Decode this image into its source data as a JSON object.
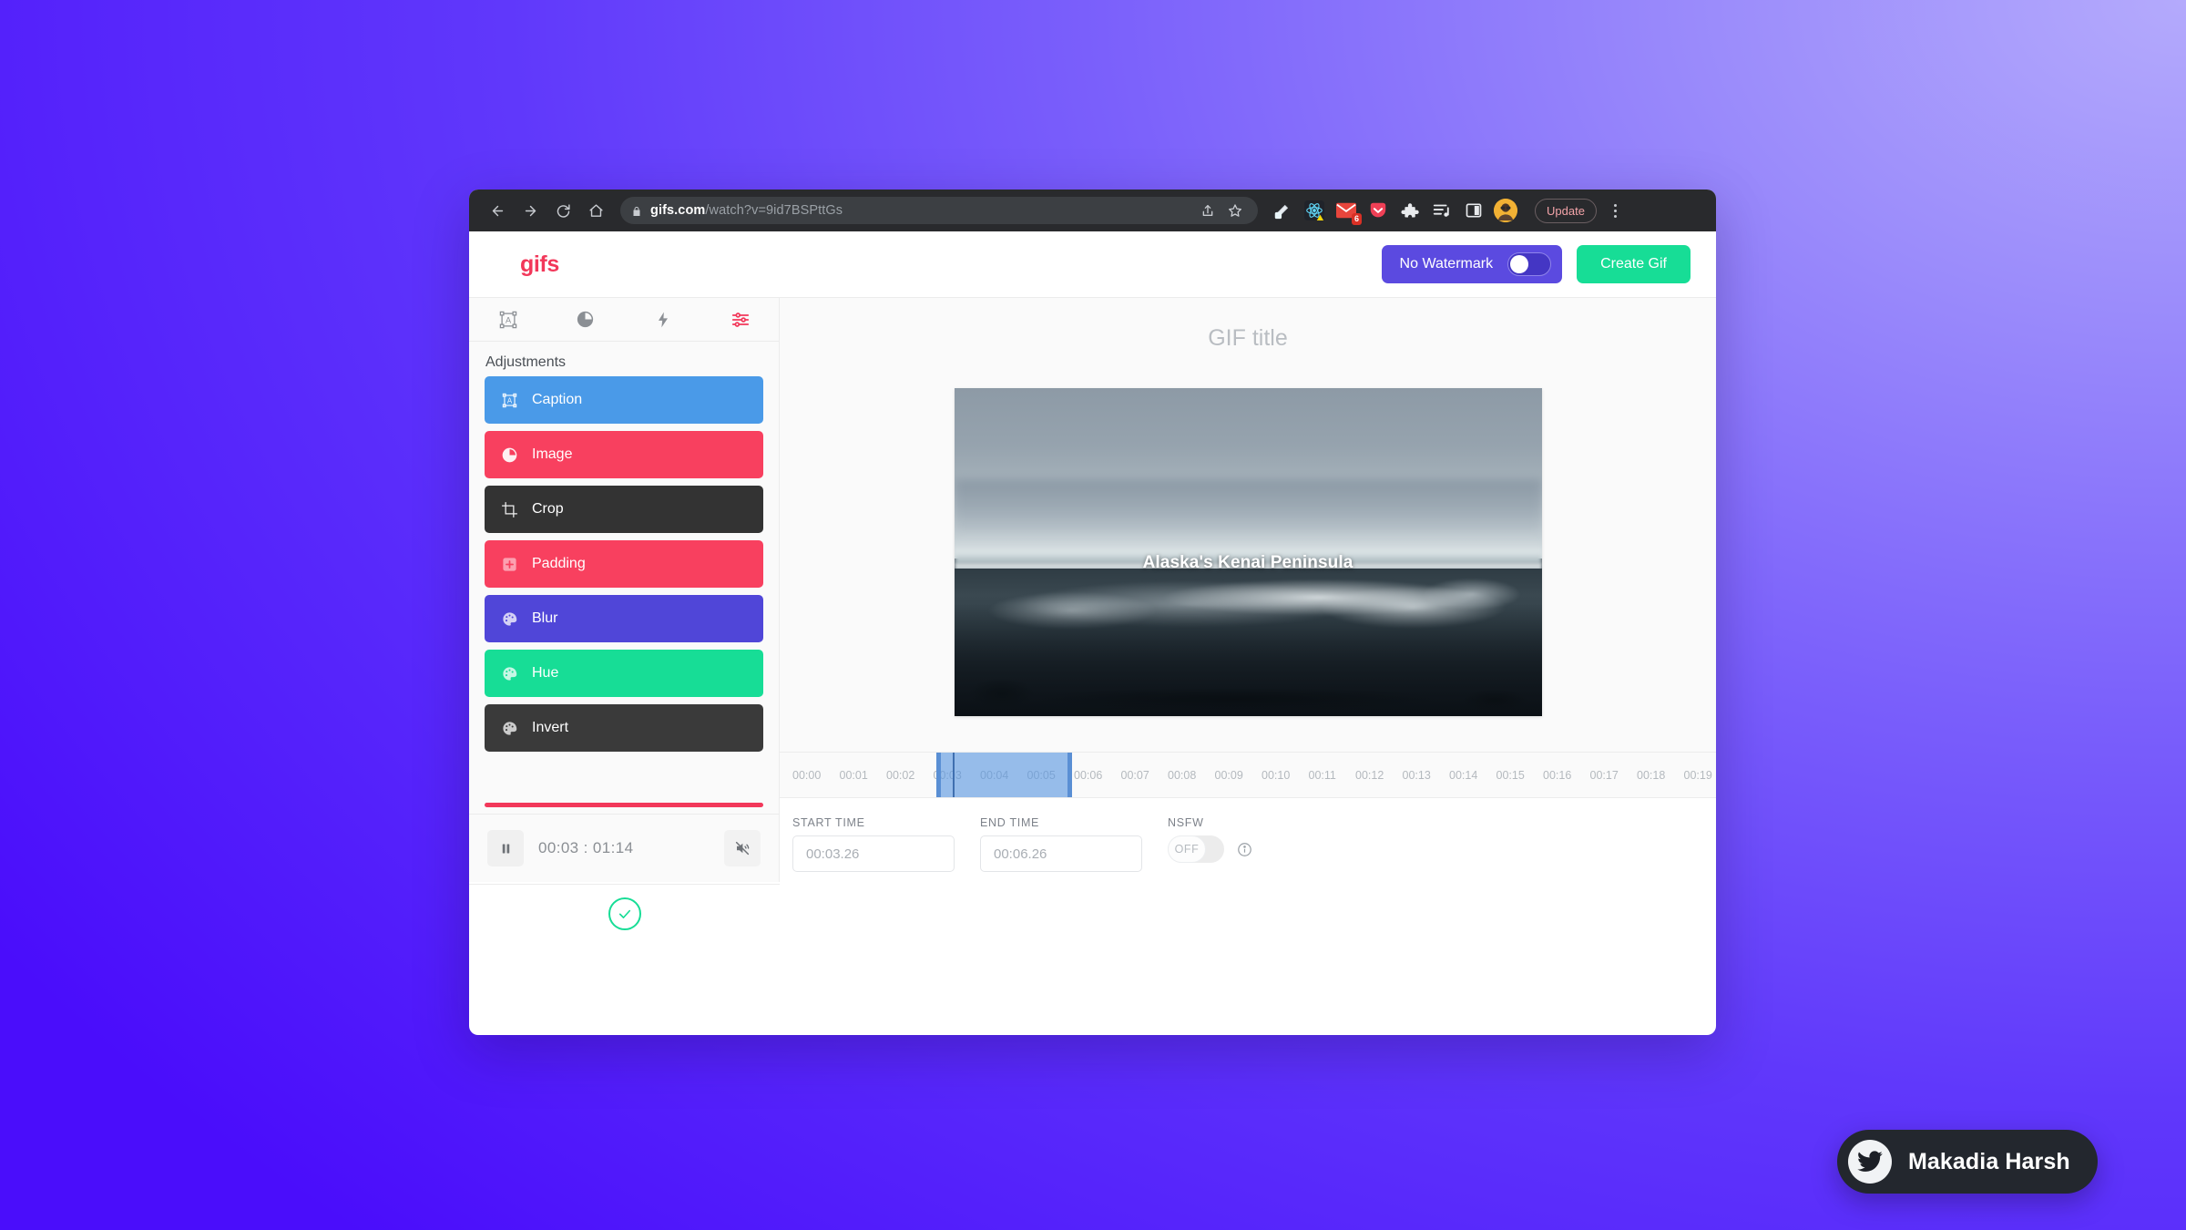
{
  "browser": {
    "url_domain": "gifs.com",
    "url_path": "/watch?v=9id7BSPttGs",
    "back_icon": "back-arrow-icon",
    "forward_icon": "forward-arrow-icon",
    "reload_icon": "reload-icon",
    "home_icon": "home-icon",
    "lock_icon": "lock-icon",
    "share_icon": "share-icon",
    "bookmark_icon": "star-icon",
    "update_label": "Update",
    "extensions": [
      {
        "name": "eyedropper-extension-icon",
        "badge": ""
      },
      {
        "name": "react-devtools-extension-icon",
        "badge": ""
      },
      {
        "name": "gmail-extension-icon",
        "badge": "6"
      },
      {
        "name": "pocket-extension-icon",
        "badge": ""
      },
      {
        "name": "puzzle-extensions-icon",
        "badge": ""
      },
      {
        "name": "playlist-extension-icon",
        "badge": ""
      },
      {
        "name": "sidebar-panel-icon",
        "badge": ""
      }
    ]
  },
  "header": {
    "logo": "gifs",
    "watermark_label": "No Watermark",
    "watermark_state": "off",
    "create_label": "Create Gif",
    "accent_green": "#17dd96",
    "accent_purple": "#5b4ae0",
    "accent_pink": "#f2385a"
  },
  "sidebar": {
    "tabs": [
      {
        "icon": "caption-box-icon",
        "active": false
      },
      {
        "icon": "contrast-circle-icon",
        "active": false
      },
      {
        "icon": "lightning-bolt-icon",
        "active": false
      },
      {
        "icon": "sliders-adjust-icon",
        "active": true
      }
    ],
    "section_title": "Adjustments",
    "items": [
      {
        "label": "Caption",
        "icon": "caption-box-icon",
        "color": "#4a9ae8"
      },
      {
        "label": "Image",
        "icon": "contrast-circle-icon",
        "color": "#f8405f"
      },
      {
        "label": "Crop",
        "icon": "crop-icon",
        "color": "#333333"
      },
      {
        "label": "Padding",
        "icon": "plus-square-icon",
        "color": "#f8405f"
      },
      {
        "label": "Blur",
        "icon": "palette-icon",
        "color": "#5046d8"
      },
      {
        "label": "Hue",
        "icon": "palette-icon",
        "color": "#17dd96"
      },
      {
        "label": "Invert",
        "icon": "palette-icon",
        "color": "#3a3a3a"
      }
    ],
    "scroll_accent": "#f2385a"
  },
  "player": {
    "play_state": "playing",
    "pause_icon": "pause-icon",
    "time_display": "00:03 : 01:14",
    "current_time": "00:03",
    "total_time": "01:14",
    "mute_icon": "speaker-muted-icon",
    "muted": true
  },
  "main": {
    "title_placeholder": "GIF title",
    "caption_overlay": "Alaska's Kenai Peninsula"
  },
  "timeline": {
    "ticks": [
      "00:00",
      "00:01",
      "00:02",
      "00:03",
      "00:04",
      "00:05",
      "00:06",
      "00:07",
      "00:08",
      "00:09",
      "00:10",
      "00:11",
      "00:12",
      "00:13",
      "00:14",
      "00:15",
      "00:16",
      "00:17",
      "00:18",
      "00:19"
    ],
    "selection_start": "00:03",
    "selection_end": "00:06",
    "selection_color": "#5896e1"
  },
  "form": {
    "start_label": "START TIME",
    "start_value": "00:03.26",
    "end_label": "END TIME",
    "end_value": "00:06.26",
    "nsfw_label": "NSFW",
    "nsfw_state": "OFF",
    "info_icon": "info-icon",
    "confirm_icon": "check-circle-icon"
  },
  "widget": {
    "name": "Makadia Harsh",
    "icon": "twitter-bird-icon"
  }
}
